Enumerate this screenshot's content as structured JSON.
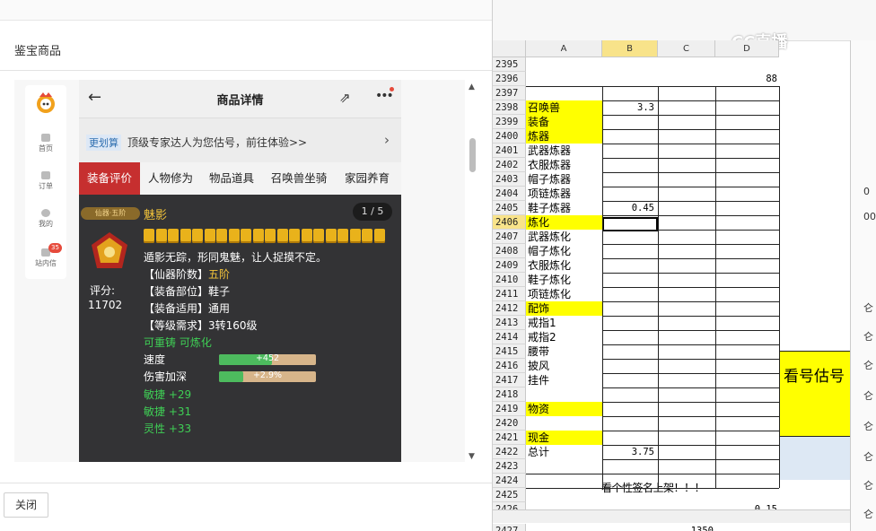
{
  "dialog": {
    "title": "鉴宝商品",
    "close_label": "关闭"
  },
  "sidebar": {
    "items": [
      {
        "label": "首页"
      },
      {
        "label": "订单"
      },
      {
        "label": "我的"
      },
      {
        "label": "站内信",
        "badge": "35"
      }
    ]
  },
  "phone": {
    "title": "商品详情",
    "banner": {
      "tag": "更划算",
      "text": "顶级专家达人为您估号，前往体验>>"
    },
    "tabs": [
      "装备评价",
      "人物修为",
      "物品道具",
      "召唤兽坐骑",
      "家园养育"
    ],
    "active_tab": "装备评价",
    "item": {
      "tier_pill": "仙器·五阶",
      "name": "魅影",
      "pager": "1 / 5",
      "star_count": 20,
      "desc": "遁影无踪，形同鬼魅，让人捉摸不定。",
      "score_label": "评分:",
      "score": "11702",
      "attrs": [
        {
          "key": "【仙器阶数】",
          "value": "五阶"
        },
        {
          "key": "【装备部位】",
          "value": "鞋子"
        },
        {
          "key": "【装备适用】",
          "value": "通用"
        },
        {
          "key": "【等级需求】",
          "value": "3转160级"
        }
      ],
      "flags": "可重铸 可炼化",
      "bars": [
        {
          "label": "速度",
          "value": "+452",
          "fill": 0.55
        },
        {
          "label": "伤害加深",
          "value": "+2.9%",
          "fill": 0.25
        }
      ],
      "bonuses": [
        "敏捷 +29",
        "敏捷 +31",
        "灵性 +33"
      ]
    }
  },
  "excel": {
    "watermark": "CC直播",
    "columns": [
      "A",
      "B",
      "C",
      "D"
    ],
    "selected_column": "B",
    "selected_row": "2406",
    "rows": [
      {
        "n": "2395",
        "a": "",
        "b": "",
        "d": ""
      },
      {
        "n": "2396",
        "a": "",
        "b": "",
        "d": "88"
      },
      {
        "n": "2397",
        "a": "",
        "b": "",
        "d": ""
      },
      {
        "n": "2398",
        "a": "召唤兽",
        "b": "3.3",
        "d": ""
      },
      {
        "n": "2399",
        "a": "装备",
        "b": "",
        "d": ""
      },
      {
        "n": "2400",
        "a": "炼器",
        "b": "",
        "d": ""
      },
      {
        "n": "2401",
        "a": "武器炼器",
        "b": "",
        "d": ""
      },
      {
        "n": "2402",
        "a": "衣服炼器",
        "b": "",
        "d": ""
      },
      {
        "n": "2403",
        "a": "帽子炼器",
        "b": "",
        "d": ""
      },
      {
        "n": "2404",
        "a": "项链炼器",
        "b": "",
        "d": ""
      },
      {
        "n": "2405",
        "a": "鞋子炼器",
        "b": "0.45",
        "d": ""
      },
      {
        "n": "2406",
        "a": "炼化",
        "b": "",
        "d": ""
      },
      {
        "n": "2407",
        "a": "武器炼化",
        "b": "",
        "d": ""
      },
      {
        "n": "2408",
        "a": "帽子炼化",
        "b": "",
        "d": ""
      },
      {
        "n": "2409",
        "a": "衣服炼化",
        "b": "",
        "d": ""
      },
      {
        "n": "2410",
        "a": "鞋子炼化",
        "b": "",
        "d": ""
      },
      {
        "n": "2411",
        "a": "项链炼化",
        "b": "",
        "d": ""
      },
      {
        "n": "2412",
        "a": "配饰",
        "b": "",
        "d": ""
      },
      {
        "n": "2413",
        "a": "戒指1",
        "b": "",
        "d": ""
      },
      {
        "n": "2414",
        "a": "戒指2",
        "b": "",
        "d": ""
      },
      {
        "n": "2415",
        "a": "腰带",
        "b": "",
        "d": ""
      },
      {
        "n": "2416",
        "a": "披风",
        "b": "",
        "d": ""
      },
      {
        "n": "2417",
        "a": "挂件",
        "b": "",
        "d": ""
      },
      {
        "n": "2418",
        "a": "",
        "b": "",
        "d": ""
      },
      {
        "n": "2419",
        "a": "物资",
        "b": "",
        "d": ""
      },
      {
        "n": "2420",
        "a": "",
        "b": "",
        "d": ""
      },
      {
        "n": "2421",
        "a": "现金",
        "b": "",
        "d": ""
      },
      {
        "n": "2422",
        "a": "总计",
        "b": "3.75",
        "d": ""
      },
      {
        "n": "2423",
        "a": "",
        "b": "",
        "d": ""
      },
      {
        "n": "2424",
        "a": "",
        "b": "",
        "d": ""
      },
      {
        "n": "2425",
        "a": "",
        "b": "",
        "d": ""
      },
      {
        "n": "2426",
        "a": "",
        "b": "",
        "d": "0.15"
      }
    ],
    "row_2424_text": "看个性签名上架！！！",
    "estimate_label": "看号估号",
    "partial_row": {
      "n": "2427",
      "c": "1350"
    },
    "right_edge": [
      "0",
      "00",
      "仑",
      "仑",
      "仑",
      "仑",
      "仑",
      "仑",
      "仑",
      "仑",
      "仑"
    ]
  },
  "colors": {
    "accent_red": "#c62f2f",
    "cell_yellow": "#ffff00",
    "gold": "#f2c33a",
    "green": "#3fcf55"
  }
}
